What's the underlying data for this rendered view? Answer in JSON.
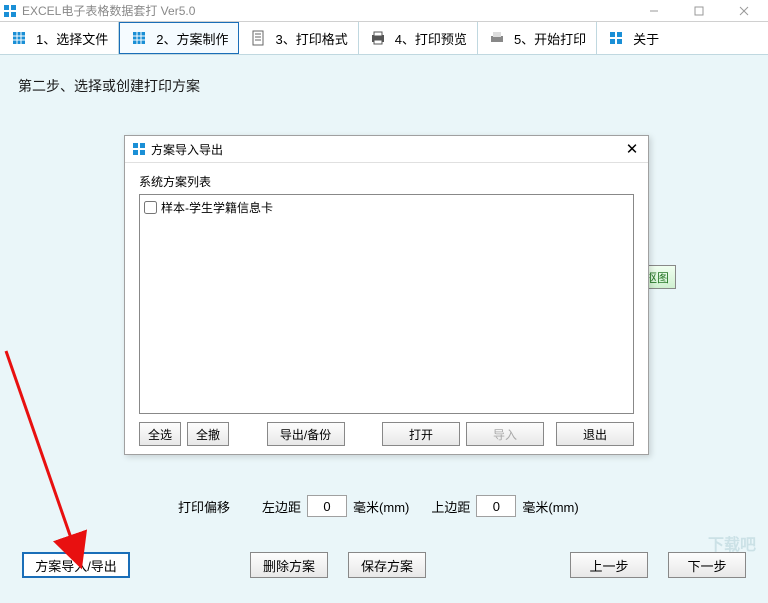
{
  "window": {
    "title": "EXCEL电子表格数据套打 Ver5.0"
  },
  "toolbar": {
    "items": [
      {
        "label": "1、选择文件"
      },
      {
        "label": "2、方案制作"
      },
      {
        "label": "3、打印格式"
      },
      {
        "label": "4、打印预览"
      },
      {
        "label": "5、开始打印"
      },
      {
        "label": "关于"
      }
    ]
  },
  "step_title": "第二步、选择或创建打印方案",
  "side_button": "抠图",
  "offset": {
    "label": "打印偏移",
    "left_label": "左边距",
    "left_value": "0",
    "left_unit": "毫米(mm)",
    "top_label": "上边距",
    "top_value": "0",
    "top_unit": "毫米(mm)"
  },
  "bottom": {
    "import_export": "方案导入/导出",
    "delete": "删除方案",
    "save": "保存方案",
    "prev": "上一步",
    "next": "下一步"
  },
  "dialog": {
    "title": "方案导入导出",
    "list_label": "系统方案列表",
    "items": [
      {
        "label": "样本-学生学籍信息卡",
        "checked": false
      }
    ],
    "btns": {
      "select_all": "全选",
      "deselect_all": "全撤",
      "export": "导出/备份",
      "open": "打开",
      "import": "导入",
      "exit": "退出"
    }
  },
  "watermark": "下载吧"
}
